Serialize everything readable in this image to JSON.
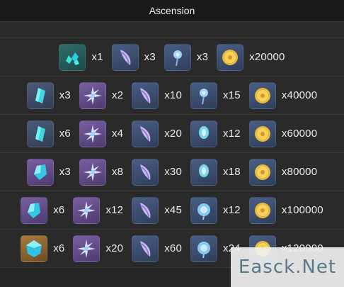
{
  "title": "Ascension",
  "rows": [
    {
      "items": [
        {
          "icon": "teal-gem-chunks-icon",
          "bg": "bg-green",
          "qty": "x1"
        },
        {
          "icon": "purple-feather-icon",
          "bg": "bg-blue",
          "qty": "x3"
        },
        {
          "icon": "blue-flower-icon",
          "bg": "bg-blue",
          "qty": "x3"
        },
        {
          "icon": "mora-coin-icon",
          "bg": "bg-blue",
          "qty": "x20000"
        }
      ]
    },
    {
      "items": [
        {
          "icon": "teal-gem-sliver-icon",
          "bg": "bg-gray",
          "qty": "x3"
        },
        {
          "icon": "crystal-flower-icon",
          "bg": "bg-purple",
          "qty": "x2"
        },
        {
          "icon": "purple-feather-icon",
          "bg": "bg-blue",
          "qty": "x10"
        },
        {
          "icon": "blue-flower-icon",
          "bg": "bg-blue",
          "qty": "x15"
        },
        {
          "icon": "mora-coin-icon",
          "bg": "bg-blue",
          "qty": "x40000"
        }
      ]
    },
    {
      "items": [
        {
          "icon": "teal-gem-sliver-icon",
          "bg": "bg-gray",
          "qty": "x6"
        },
        {
          "icon": "crystal-flower-icon",
          "bg": "bg-purple",
          "qty": "x4"
        },
        {
          "icon": "purple-feather-icon",
          "bg": "bg-blue",
          "qty": "x20"
        },
        {
          "icon": "blue-flower-bud-icon",
          "bg": "bg-blue",
          "qty": "x12"
        },
        {
          "icon": "mora-coin-icon",
          "bg": "bg-blue",
          "qty": "x60000"
        }
      ]
    },
    {
      "items": [
        {
          "icon": "teal-gem-fragment-icon",
          "bg": "bg-purple",
          "qty": "x3"
        },
        {
          "icon": "crystal-flower-icon",
          "bg": "bg-purple",
          "qty": "x8"
        },
        {
          "icon": "purple-feather-icon",
          "bg": "bg-blue",
          "qty": "x30"
        },
        {
          "icon": "blue-flower-bud-icon",
          "bg": "bg-blue",
          "qty": "x18"
        },
        {
          "icon": "mora-coin-icon",
          "bg": "bg-blue",
          "qty": "x80000"
        }
      ]
    },
    {
      "items": [
        {
          "icon": "teal-gem-fragment-icon",
          "bg": "bg-purple",
          "qty": "x6"
        },
        {
          "icon": "crystal-flower-icon",
          "bg": "bg-purple",
          "qty": "x12"
        },
        {
          "icon": "purple-feather-icon",
          "bg": "bg-blue",
          "qty": "x45"
        },
        {
          "icon": "blue-flower-bloom-icon",
          "bg": "bg-blue",
          "qty": "x12"
        },
        {
          "icon": "mora-coin-icon",
          "bg": "bg-blue",
          "qty": "x100000"
        }
      ]
    },
    {
      "items": [
        {
          "icon": "teal-gem-icon",
          "bg": "bg-gold",
          "qty": "x6"
        },
        {
          "icon": "crystal-flower-icon",
          "bg": "bg-purple",
          "qty": "x20"
        },
        {
          "icon": "purple-feather-icon",
          "bg": "bg-blue",
          "qty": "x60"
        },
        {
          "icon": "blue-flower-bloom-icon",
          "bg": "bg-blue",
          "qty": "x24"
        },
        {
          "icon": "mora-coin-icon",
          "bg": "bg-blue",
          "qty": "x120000"
        }
      ]
    }
  ],
  "watermark": "Easck.Net"
}
